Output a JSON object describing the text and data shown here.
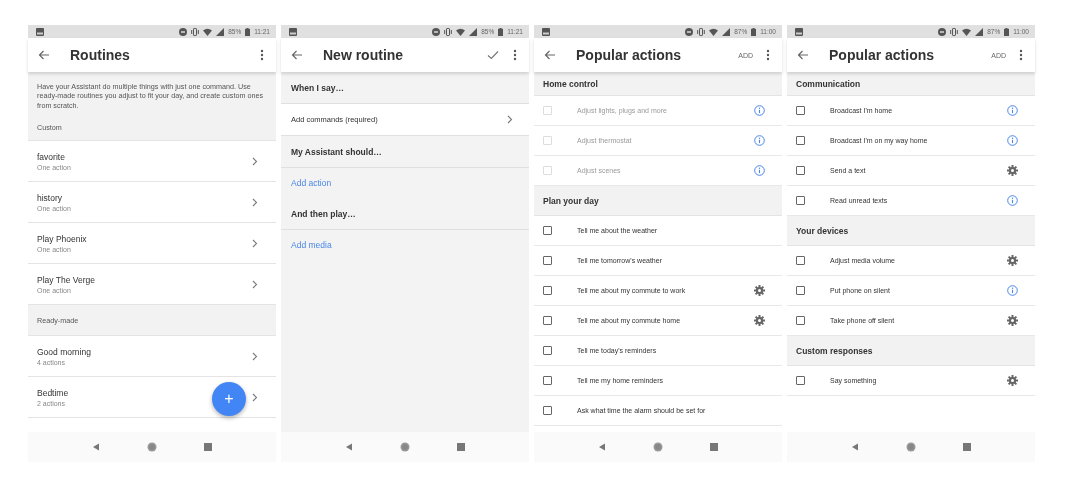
{
  "screens": [
    {
      "kind": "routines",
      "status": {
        "battery": "85%",
        "time": "11:21"
      },
      "app_bar": {
        "title": "Routines"
      },
      "intro": "Have your Assistant do multiple things with just one command. Use ready-made routines you adjust to fit your day, and create custom ones from scratch.",
      "groups": [
        {
          "heading": "Custom",
          "items": [
            {
              "title": "favorite",
              "subtitle": "One action"
            },
            {
              "title": "history",
              "subtitle": "One action"
            },
            {
              "title": "Play Phoenix",
              "subtitle": "One action"
            },
            {
              "title": "Play The Verge",
              "subtitle": "One action"
            }
          ]
        },
        {
          "heading": "Ready-made",
          "items": [
            {
              "title": "Good morning",
              "subtitle": "4 actions"
            },
            {
              "title": "Bedtime",
              "subtitle": "2 actions"
            }
          ]
        }
      ],
      "fab": "+"
    },
    {
      "kind": "editor",
      "status": {
        "battery": "85%",
        "time": "11:21"
      },
      "app_bar": {
        "title": "New routine",
        "confirm": true
      },
      "sections": [
        {
          "heading": "When I say…",
          "rows": [
            {
              "kind": "nav",
              "text": "Add commands (required)"
            }
          ]
        },
        {
          "heading": "My Assistant should…",
          "rows": [
            {
              "kind": "link",
              "text": "Add action"
            }
          ]
        },
        {
          "heading": "And then play…",
          "rows": [
            {
              "kind": "link",
              "text": "Add media"
            }
          ]
        }
      ]
    },
    {
      "kind": "actions",
      "status": {
        "battery": "87%",
        "time": "11:00"
      },
      "app_bar": {
        "title": "Popular actions",
        "action": "ADD"
      },
      "groups": [
        {
          "heading": "Home control",
          "items": [
            {
              "label": "Adjust lights, plugs and more",
              "checked": false,
              "disabled": true,
              "kind": "info"
            },
            {
              "label": "Adjust thermostat",
              "checked": false,
              "disabled": true,
              "kind": "info"
            },
            {
              "label": "Adjust scenes",
              "checked": false,
              "disabled": true,
              "kind": "info"
            }
          ]
        },
        {
          "heading": "Plan your day",
          "items": [
            {
              "label": "Tell me about the weather",
              "checked": false,
              "disabled": false,
              "kind": "plain"
            },
            {
              "label": "Tell me tomorrow's weather",
              "checked": false,
              "disabled": false,
              "kind": "plain"
            },
            {
              "label": "Tell me about my commute to work",
              "checked": false,
              "disabled": false,
              "kind": "settings"
            },
            {
              "label": "Tell me about my commute home",
              "checked": false,
              "disabled": false,
              "kind": "settings"
            },
            {
              "label": "Tell me today's reminders",
              "checked": false,
              "disabled": false,
              "kind": "plain"
            },
            {
              "label": "Tell me my home reminders",
              "checked": false,
              "disabled": false,
              "kind": "plain"
            },
            {
              "label": "Ask what time the alarm should be set for",
              "checked": false,
              "disabled": false,
              "kind": "plain"
            }
          ]
        }
      ]
    },
    {
      "kind": "actions",
      "status": {
        "battery": "87%",
        "time": "11:00"
      },
      "app_bar": {
        "title": "Popular actions",
        "action": "ADD"
      },
      "groups": [
        {
          "heading": "Communication",
          "items": [
            {
              "label": "Broadcast I'm home",
              "checked": false,
              "disabled": false,
              "kind": "info"
            },
            {
              "label": "Broadcast I'm on my way home",
              "checked": false,
              "disabled": false,
              "kind": "info"
            },
            {
              "label": "Send a text",
              "checked": false,
              "disabled": false,
              "kind": "settings"
            },
            {
              "label": "Read unread texts",
              "checked": false,
              "disabled": false,
              "kind": "info"
            }
          ]
        },
        {
          "heading": "Your devices",
          "items": [
            {
              "label": "Adjust media volume",
              "checked": false,
              "disabled": false,
              "kind": "settings"
            },
            {
              "label": "Put phone on silent",
              "checked": false,
              "disabled": false,
              "kind": "info"
            },
            {
              "label": "Take phone off silent",
              "checked": false,
              "disabled": false,
              "kind": "settings"
            }
          ]
        },
        {
          "heading": "Custom responses",
          "items": [
            {
              "label": "Say something",
              "checked": false,
              "disabled": false,
              "kind": "settings"
            }
          ]
        }
      ]
    }
  ]
}
